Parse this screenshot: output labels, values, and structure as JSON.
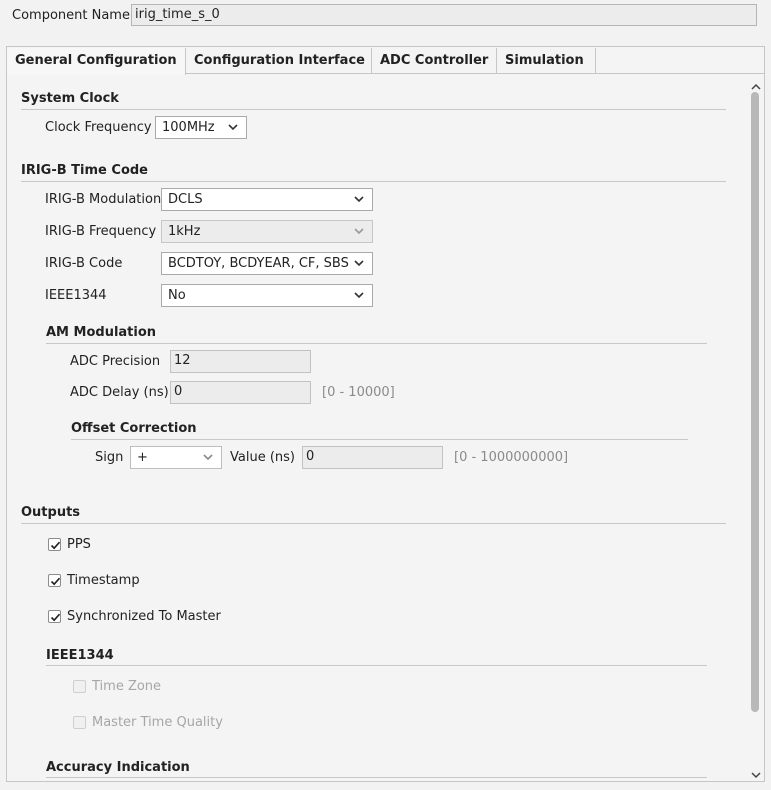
{
  "component": {
    "label": "Component Name",
    "value": "irig_time_s_0"
  },
  "tabs": [
    {
      "label": "General Configuration",
      "active": true
    },
    {
      "label": "Configuration Interface",
      "active": false
    },
    {
      "label": "ADC Controller",
      "active": false
    },
    {
      "label": "Simulation",
      "active": false
    }
  ],
  "system_clock": {
    "title": "System Clock",
    "clock_frequency_label": "Clock Frequency",
    "clock_frequency_value": "100MHz"
  },
  "irig": {
    "title": "IRIG-B Time Code",
    "modulation_label": "IRIG-B Modulation",
    "modulation_value": "DCLS",
    "frequency_label": "IRIG-B Frequency",
    "frequency_value": "1kHz",
    "code_label": "IRIG-B Code",
    "code_value": "BCDTOY, BCDYEAR, CF, SBS",
    "ieee_label": "IEEE1344",
    "ieee_value": "No"
  },
  "am": {
    "title": "AM Modulation",
    "precision_label": "ADC Precision",
    "precision_value": "12",
    "delay_label": "ADC Delay (ns)",
    "delay_value": "0",
    "delay_range": "[0 - 10000]"
  },
  "offset": {
    "title": "Offset Correction",
    "sign_label": "Sign",
    "sign_value": "+",
    "value_label": "Value (ns)",
    "value_value": "0",
    "value_range": "[0 - 1000000000]"
  },
  "outputs": {
    "title": "Outputs",
    "items": [
      {
        "label": "PPS",
        "checked": true
      },
      {
        "label": "Timestamp",
        "checked": true
      },
      {
        "label": "Synchronized To Master",
        "checked": true
      }
    ]
  },
  "ieee1344": {
    "title": "IEEE1344",
    "items": [
      {
        "label": "Time Zone",
        "checked": false,
        "disabled": true
      },
      {
        "label": "Master Time Quality",
        "checked": false,
        "disabled": true
      }
    ]
  },
  "accuracy": {
    "title": "Accuracy Indication"
  },
  "icons": {
    "dropdown": "chevron-down-icon",
    "check": "checkmark-icon",
    "scroll_up": "chevron-up-icon",
    "scroll_down": "chevron-down-icon"
  }
}
